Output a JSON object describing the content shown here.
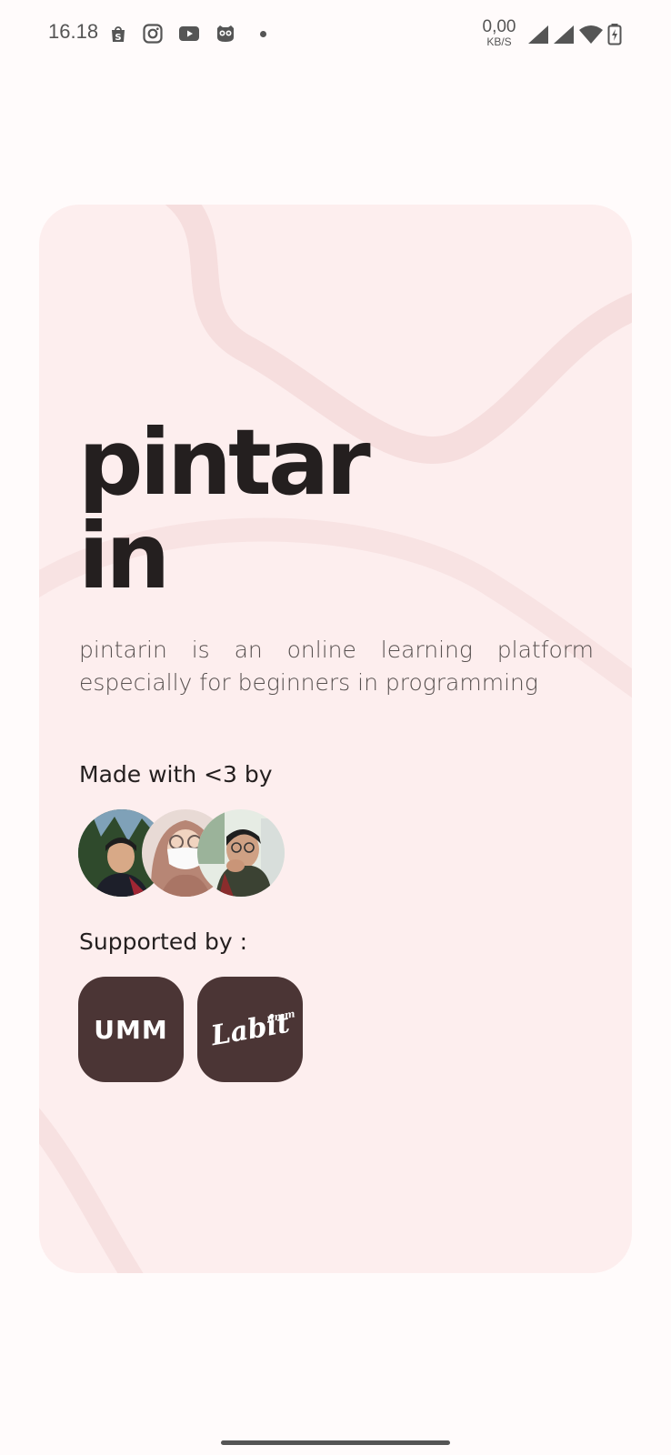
{
  "status_bar": {
    "time": "16.18",
    "notification_icons": [
      "shopee-icon",
      "instagram-icon",
      "youtube-icon",
      "owl-icon"
    ],
    "net_speed_value": "0,00",
    "net_speed_unit": "KB/S",
    "system_icons": [
      "signal-icon",
      "signal-icon",
      "wifi-icon",
      "battery-charging-icon"
    ]
  },
  "hero": {
    "brand_line1": "pintar",
    "brand_line2": "in",
    "tagline": "pintarin is an online learning platform especially for beginners in programming"
  },
  "credits": {
    "made_by_label": "Made with <3 by",
    "supported_label": "Supported by :",
    "sponsors": [
      {
        "name": "UMM",
        "label": "UMM"
      },
      {
        "name": "Labit",
        "label": "Labit",
        "sub": "umm"
      }
    ]
  },
  "colors": {
    "page_bg": "#fffbfb",
    "card_bg": "#fdeeee",
    "text_dark": "#241f1f",
    "text_muted": "#57504f",
    "sponsor_bg": "#4b3535"
  }
}
